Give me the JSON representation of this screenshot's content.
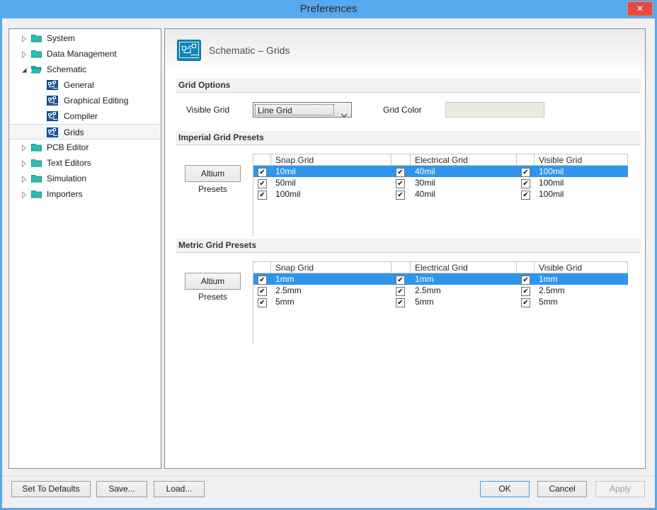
{
  "window": {
    "title": "Preferences",
    "close_glyph": "✕"
  },
  "sidebar": {
    "items": [
      {
        "label": "System",
        "icon": "folder-icon",
        "arrow": "collapsed",
        "level": 0
      },
      {
        "label": "Data Management",
        "icon": "folder-icon",
        "arrow": "collapsed",
        "level": 0
      },
      {
        "label": "Schematic",
        "icon": "open-folder-icon",
        "arrow": "expanded",
        "level": 0
      },
      {
        "label": "General",
        "icon": "schematic-page-icon",
        "level": 1
      },
      {
        "label": "Graphical Editing",
        "icon": "schematic-page-icon",
        "level": 1
      },
      {
        "label": "Compiler",
        "icon": "schematic-page-icon",
        "level": 1
      },
      {
        "label": "Grids",
        "icon": "schematic-page-icon",
        "level": 1,
        "selected": true
      },
      {
        "label": "PCB Editor",
        "icon": "folder-icon",
        "arrow": "collapsed",
        "level": 0
      },
      {
        "label": "Text Editors",
        "icon": "folder-icon",
        "arrow": "collapsed",
        "level": 0
      },
      {
        "label": "Simulation",
        "icon": "folder-icon",
        "arrow": "collapsed",
        "level": 0
      },
      {
        "label": "Importers",
        "icon": "folder-icon",
        "arrow": "collapsed",
        "level": 0
      }
    ]
  },
  "main": {
    "header": {
      "title": "Schematic – Grids",
      "icon": "schematic-page-icon"
    },
    "grid_options": {
      "section_title": "Grid Options",
      "visible_grid_label": "Visible Grid",
      "visible_grid_value": "Line Grid",
      "grid_color_label": "Grid Color",
      "grid_color_value": "#ebebe4"
    },
    "imperial": {
      "section_title": "Imperial Grid Presets",
      "presets_button": "Altium Presets",
      "columns": [
        "Snap Grid",
        "Electrical Grid",
        "Visible Grid"
      ],
      "all_checkboxes_checked": true,
      "check_glyph": "✔",
      "rows": [
        {
          "snap": "10mil",
          "electrical": "40mil",
          "visible": "100mil",
          "selected": true
        },
        {
          "snap": "50mil",
          "electrical": "30mil",
          "visible": "100mil",
          "selected": false
        },
        {
          "snap": "100mil",
          "electrical": "40mil",
          "visible": "100mil",
          "selected": false
        }
      ]
    },
    "metric": {
      "section_title": "Metric Grid Presets",
      "presets_button": "Altium Presets",
      "columns": [
        "Snap Grid",
        "Electrical Grid",
        "Visible Grid"
      ],
      "all_checkboxes_checked": true,
      "check_glyph": "✔",
      "rows": [
        {
          "snap": "1mm",
          "electrical": "1mm",
          "visible": "1mm",
          "selected": true
        },
        {
          "snap": "2.5mm",
          "electrical": "2.5mm",
          "visible": "2.5mm",
          "selected": false
        },
        {
          "snap": "5mm",
          "electrical": "5mm",
          "visible": "5mm",
          "selected": false
        }
      ]
    }
  },
  "footer": {
    "set_to_defaults": "Set To Defaults",
    "save": "Save...",
    "load": "Load...",
    "ok": "OK",
    "cancel": "Cancel",
    "apply": "Apply"
  },
  "colors": {
    "titlebar": "#57a8ed",
    "close_button": "#e14b42",
    "selected_row": "#3095ea",
    "folder_icon": "#2cbcb4",
    "schematic_tree_icon": "#1a5a9e",
    "header_icon": "#0e86b6",
    "grid_color_swatch": "#ebebe4"
  }
}
